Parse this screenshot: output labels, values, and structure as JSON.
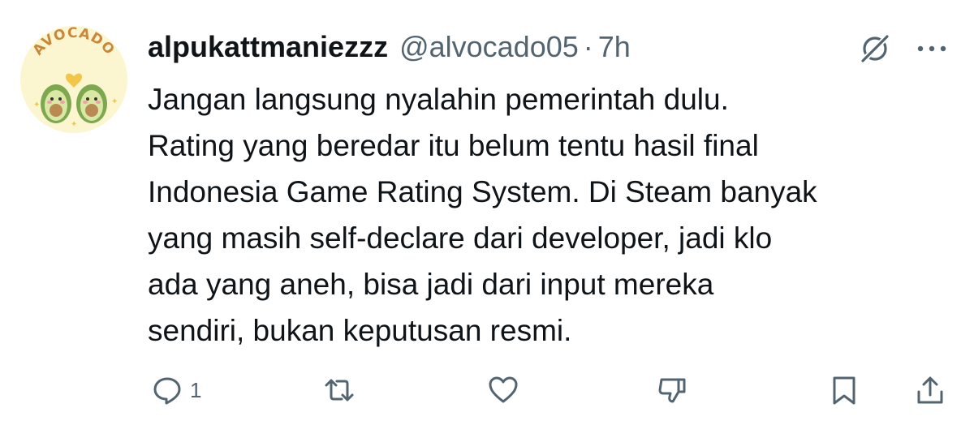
{
  "avatar": {
    "text": "AVOCADO"
  },
  "post": {
    "display_name": "alpukattmaniezzz",
    "handle": "@alvocado05",
    "separator": "·",
    "time": "7h",
    "lines": [
      "Jangan langsung nyalahin pemerintah dulu.",
      "Rating yang beredar itu belum tentu hasil final",
      "Indonesia Game Rating System. Di Steam banyak",
      "yang masih self-declare dari developer, jadi klo",
      "ada yang aneh, bisa jadi dari input mereka",
      "sendiri, bukan keputusan resmi."
    ]
  },
  "actions": {
    "reply_count": "1"
  },
  "icons": {
    "header": [
      "grok-icon",
      "more-icon"
    ],
    "actions": [
      "reply-icon",
      "retweet-icon",
      "like-icon",
      "dislike-icon",
      "bookmark-icon",
      "share-icon"
    ]
  },
  "colors": {
    "text": "#0f1419",
    "secondary": "#536471",
    "avatar_bg": "#fbf6cf",
    "avocado_green": "#8fbf5a"
  }
}
